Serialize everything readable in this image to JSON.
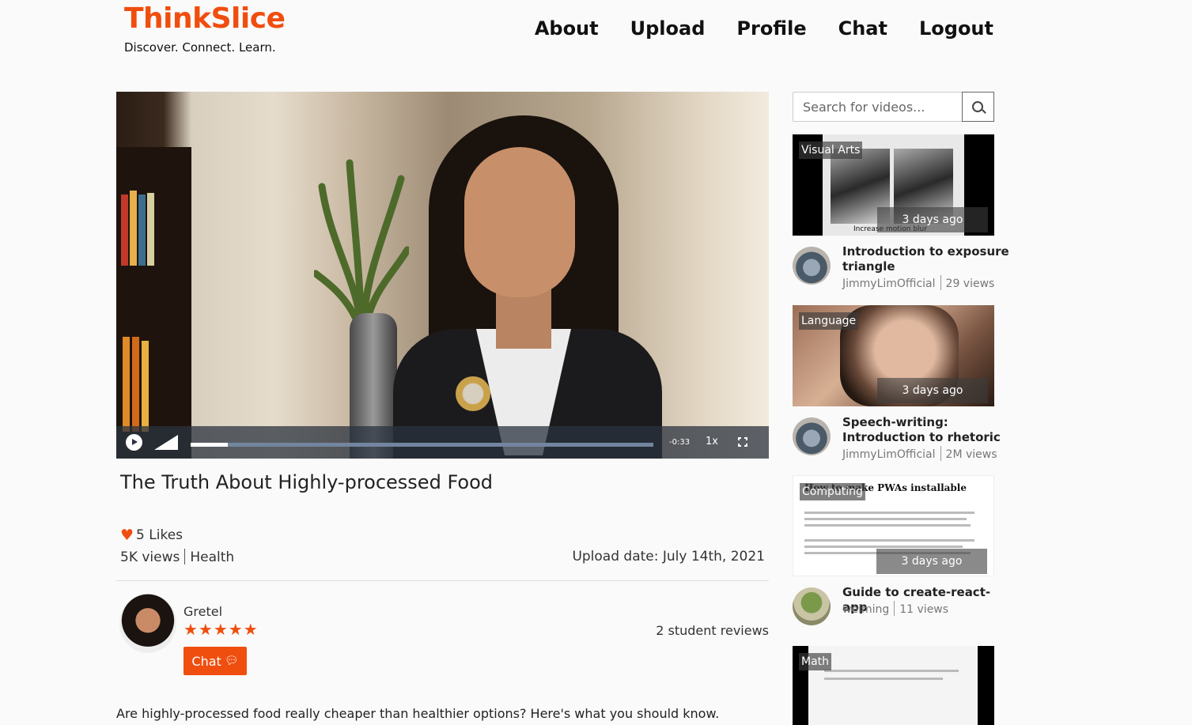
{
  "brand": {
    "name": "ThinkSlice",
    "tagline": "Discover. Connect. Learn."
  },
  "nav": [
    "About",
    "Upload",
    "Profile",
    "Chat",
    "Logout"
  ],
  "player": {
    "time_remaining": "-0:33",
    "playback_rate": "1x",
    "progress": 0.08
  },
  "video": {
    "title": "The Truth About Highly-processed Food",
    "likes": "5 Likes",
    "views": "5K views",
    "category": "Health",
    "upload_date": "Upload date: July 14th, 2021",
    "description": "Are highly-processed food really cheaper than healthier options? Here's what you should know."
  },
  "author": {
    "name": "Gretel",
    "rating": 5,
    "reviews": "2 student reviews",
    "chat_label": "Chat"
  },
  "search": {
    "placeholder": "Search for videos..."
  },
  "sidebar": [
    {
      "category": "Visual Arts",
      "ago": "3 days ago",
      "title": "Introduction to exposure triangle",
      "channel": "JimmyLimOfficial",
      "views": "29 views",
      "thumb_caption": "Increase motion blur"
    },
    {
      "category": "Language",
      "ago": "3 days ago",
      "title": "Speech-writing: Introduction to rhetoric",
      "channel": "JimmyLimOfficial",
      "views": "2M views"
    },
    {
      "category": "Computing",
      "ago": "3 days ago",
      "title": "Guide to create-react-app",
      "channel": "weiming",
      "views": "11 views",
      "thumb_heading": "How to make PWAs installable"
    },
    {
      "category": "Math"
    }
  ],
  "colors": {
    "accent": "#f04e0f"
  }
}
